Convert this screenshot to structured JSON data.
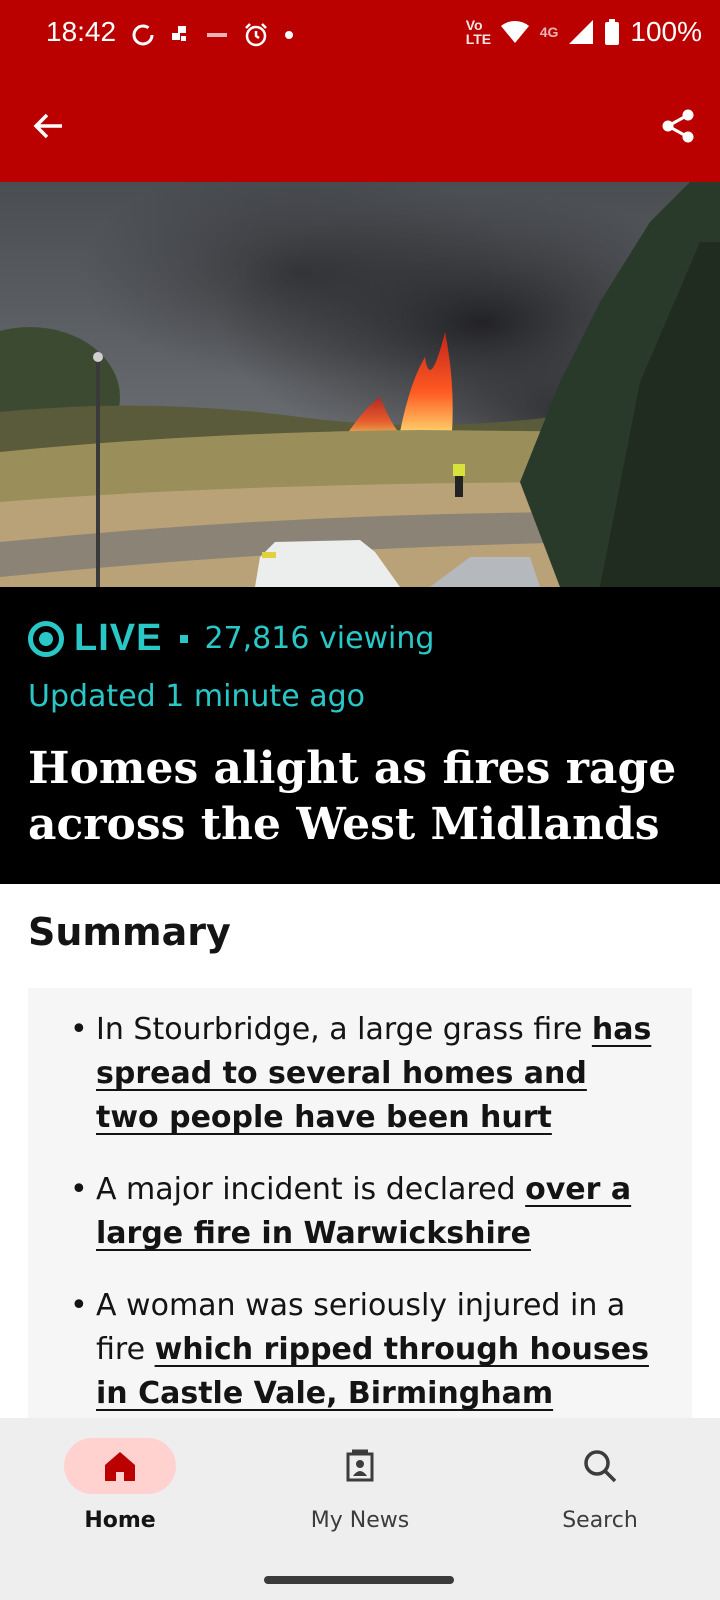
{
  "status_bar": {
    "time": "18:42",
    "network_label": "4G",
    "volte_label": "Vo LTE",
    "battery": "100%",
    "icons": [
      "sync-icon",
      "app-icon",
      "mse-icon",
      "alarm-icon",
      "dot-icon",
      "volte-icon",
      "wifi-icon",
      "signal-icon",
      "battery-icon"
    ]
  },
  "app_bar": {
    "back_icon": "arrow-left-icon",
    "share_icon": "share-icon"
  },
  "live": {
    "label": "LIVE",
    "viewing": "27,816 viewing",
    "updated": "Updated 1 minute ago",
    "headline": "Homes alight as fires rage across the West Midlands"
  },
  "summary": {
    "title": "Summary",
    "items": [
      {
        "text": "In Stourbridge, a large grass fire ",
        "link": "has spread to several homes and two people have been hurt"
      },
      {
        "text": "A major incident is declared ",
        "link": "over a large fire in Warwickshire"
      },
      {
        "text": "A woman was seriously injured in a fire ",
        "link": "which ripped through houses in Castle Vale, Birmingham"
      }
    ]
  },
  "bottom_nav": {
    "items": [
      {
        "label": "Home",
        "icon": "home-icon",
        "active": true
      },
      {
        "label": "My News",
        "icon": "my-news-icon",
        "active": false
      },
      {
        "label": "Search",
        "icon": "search-icon",
        "active": false
      }
    ]
  },
  "colors": {
    "brand_red": "#bb0000",
    "live_teal": "#2ac7c7",
    "active_pill": "#ffd2cf"
  }
}
